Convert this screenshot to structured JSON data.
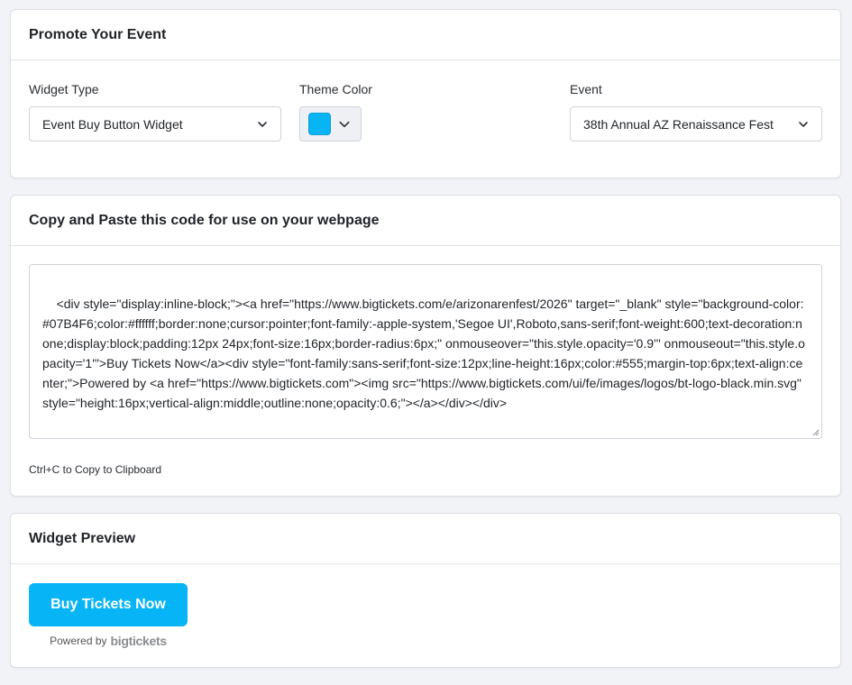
{
  "promote": {
    "title": "Promote Your Event",
    "widget_type": {
      "label": "Widget Type",
      "value": "Event Buy Button Widget"
    },
    "theme_color": {
      "label": "Theme Color",
      "value": "#07B4F6"
    },
    "event": {
      "label": "Event",
      "value": "38th Annual AZ Renaissance Fest"
    }
  },
  "code": {
    "title": "Copy and Paste this code for use on your webpage",
    "snippet": "<div style=\"display:inline-block;\"><a href=\"https://www.bigtickets.com/e/arizonarenfest/2026\" target=\"_blank\" style=\"background-color:#07B4F6;color:#ffffff;border:none;cursor:pointer;font-family:-apple-system,'Segoe UI',Roboto,sans-serif;font-weight:600;text-decoration:none;display:block;padding:12px 24px;font-size:16px;border-radius:6px;\" onmouseover=\"this.style.opacity='0.9'\" onmouseout=\"this.style.opacity='1'\">Buy Tickets Now</a><div style=\"font-family:sans-serif;font-size:12px;line-height:16px;color:#555;margin-top:6px;text-align:center;\">Powered by <a href=\"https://www.bigtickets.com\"><img src=\"https://www.bigtickets.com/ui/fe/images/logos/bt-logo-black.min.svg\" style=\"height:16px;vertical-align:middle;outline:none;opacity:0.6;\"></a></div></div>",
    "hint": "Ctrl+C to Copy to Clipboard"
  },
  "preview": {
    "title": "Widget Preview",
    "button_label": "Buy Tickets Now",
    "powered_by": "Powered by",
    "logo_text": "bigtickets"
  },
  "colors": {
    "accent": "#07B4F6",
    "background": "#f2f3f7"
  }
}
